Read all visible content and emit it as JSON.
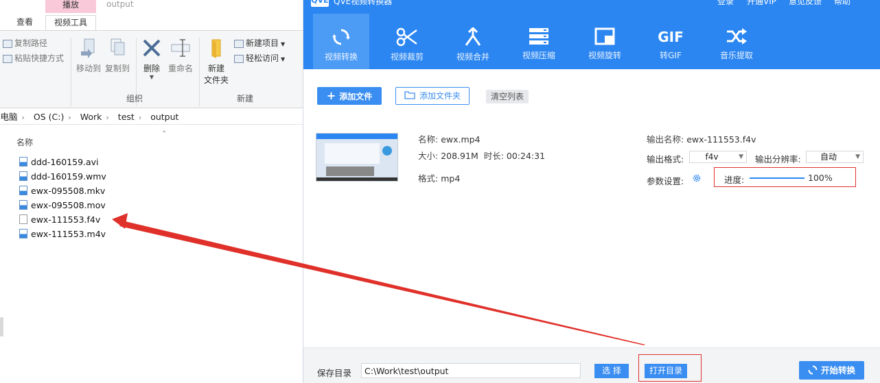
{
  "explorer": {
    "window_title": "output",
    "contextual_tab_label": "播放",
    "tabs": [
      {
        "label": "查看"
      },
      {
        "label": "视频工具"
      }
    ],
    "ribbon": {
      "copy_path": "复制路径",
      "paste_shortcut": "粘贴快捷方式",
      "move_to": "移动到",
      "copy_to": "复制到",
      "delete": "删除",
      "rename": "重命名",
      "new_folder_line1": "新建",
      "new_folder_line2": "文件夹",
      "new_item": "新建项目",
      "easy_access": "轻松访问",
      "group_organize": "组织",
      "group_new": "新建"
    },
    "breadcrumb": [
      "此电脑",
      "OS (C:)",
      "Work",
      "test",
      "output"
    ],
    "column_name": "名称",
    "files": [
      {
        "name": "ddd-160159.avi"
      },
      {
        "name": "ddd-160159.wmv"
      },
      {
        "name": "ewx-095508.mkv"
      },
      {
        "name": "ewx-095508.mov"
      },
      {
        "name": "ewx-111553.f4v"
      },
      {
        "name": "ewx-111553.m4v"
      }
    ]
  },
  "app": {
    "logo": "QVE",
    "title": "QVE视频转换器",
    "top_links": [
      "登录",
      "开通VIP",
      "意见反馈",
      "帮助"
    ],
    "tools": [
      {
        "label": "视频转换",
        "icon": "refresh-icon"
      },
      {
        "label": "视频裁剪",
        "icon": "scissors-icon"
      },
      {
        "label": "视频合并",
        "icon": "merge-icon"
      },
      {
        "label": "视频压缩",
        "icon": "compress-icon"
      },
      {
        "label": "视频旋转",
        "icon": "rotate-icon"
      },
      {
        "label": "转GIF",
        "icon": "gif-icon"
      },
      {
        "label": "音乐提取",
        "icon": "shuffle-icon"
      }
    ],
    "add_file": "添加文件",
    "add_folder": "添加文件夹",
    "clear_list": "清空列表",
    "item": {
      "name_label": "名称:",
      "name": "ewx.mp4",
      "size_label": "大小:",
      "size": "208.91M",
      "duration_label": "时长:",
      "duration": "00:24:31",
      "format_label": "格式:",
      "format": "mp4",
      "output_name_label": "输出名称:",
      "output_name": "ewx-111553.f4v",
      "output_format_label": "输出格式:",
      "output_format": "f4v",
      "output_resolution_label": "输出分辨率:",
      "output_resolution": "自动",
      "params_label": "参数设置:",
      "progress_label": "进度:",
      "progress_value": "100%",
      "progress_fraction": 1.0
    },
    "save_dir_label": "保存目录",
    "save_dir": "C:\\Work\\test\\output",
    "choose": "选 择",
    "open_dir": "打开目录",
    "start": "开始转换",
    "accent_color": "#2b86f1",
    "annotation_color": "#e0302a"
  }
}
